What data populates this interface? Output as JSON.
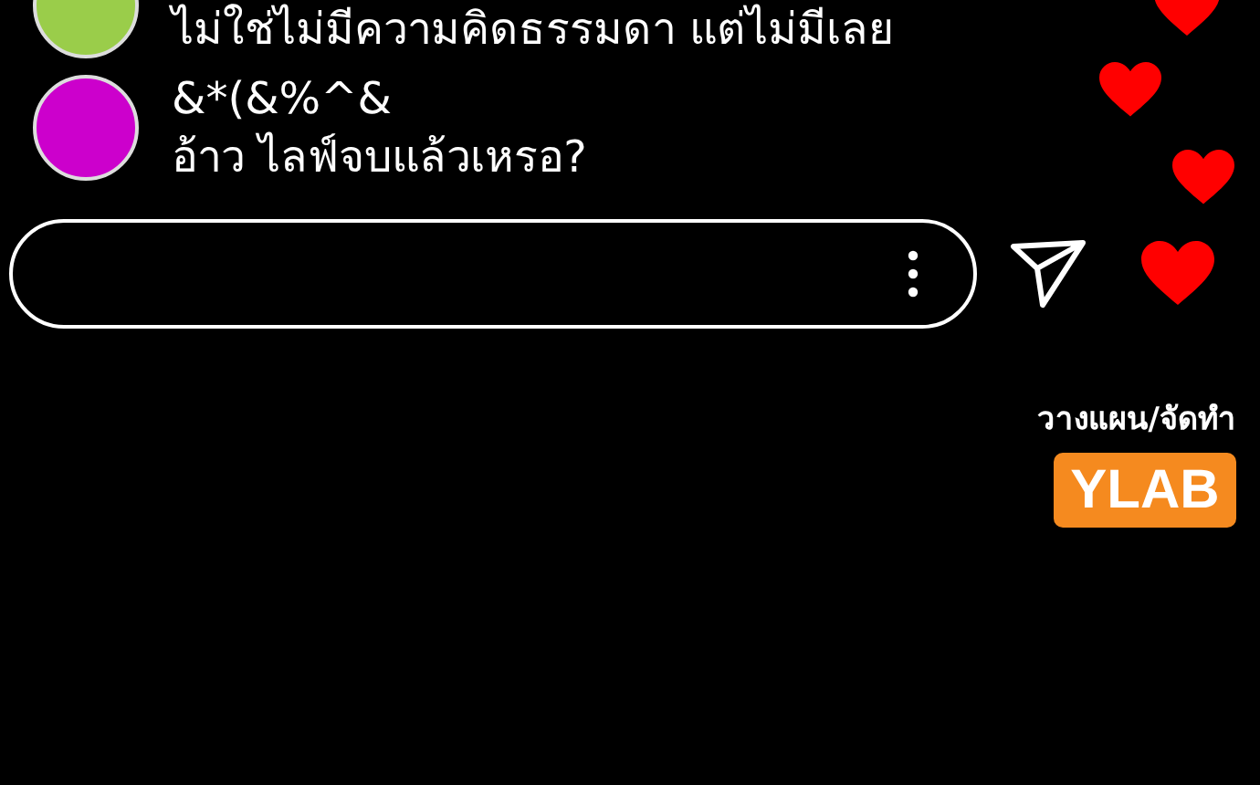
{
  "comments": [
    {
      "color": "#9acd4a",
      "lines": [
        "ไม่ใช่ไม่มีความคิดธรรมดา แต่ไม่มีเลย"
      ]
    },
    {
      "color": "#cc00cc",
      "lines": [
        "&*(&%^&",
        "อ้าว ไลฟ์จบแล้วเหรอ?"
      ]
    }
  ],
  "credit": {
    "label": "วางแผน/จัดทำ",
    "logo": "YLAB"
  }
}
